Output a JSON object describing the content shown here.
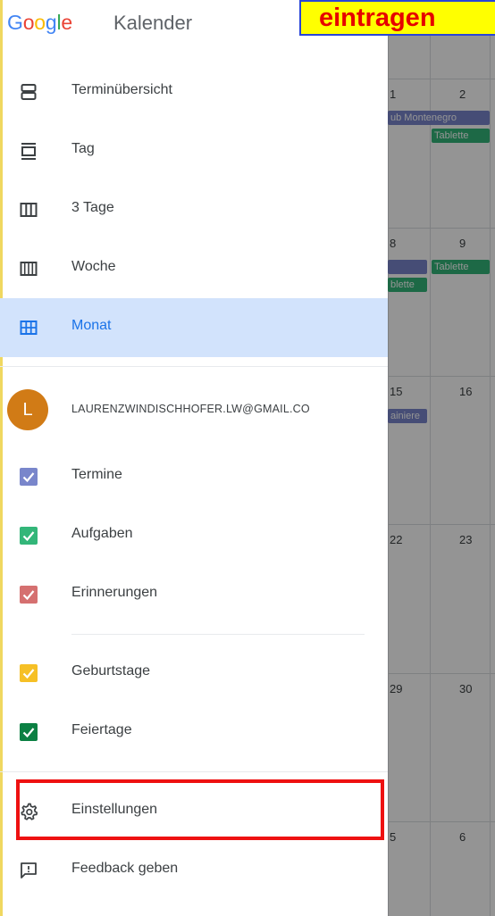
{
  "annotation": {
    "banner_text": "eintragen"
  },
  "header": {
    "logo_parts": [
      "G",
      "o",
      "o",
      "g",
      "l",
      "e"
    ],
    "app_name": "Kalender"
  },
  "views": [
    {
      "label": "Terminübersicht",
      "icon": "schedule-view-icon"
    },
    {
      "label": "Tag",
      "icon": "day-view-icon"
    },
    {
      "label": "3 Tage",
      "icon": "three-day-view-icon"
    },
    {
      "label": "Woche",
      "icon": "week-view-icon"
    },
    {
      "label": "Monat",
      "icon": "month-view-icon",
      "selected": true
    }
  ],
  "account": {
    "avatar_letter": "L",
    "email": "LAURENZWINDISCHHOFER.LW@GMAIL.CO",
    "avatar_color": "#d17b16"
  },
  "calendars": [
    {
      "label": "Termine",
      "color": "#7986cb",
      "checked": true
    },
    {
      "label": "Aufgaben",
      "color": "#33b679",
      "checked": true
    },
    {
      "label": "Erinnerungen",
      "color": "#d57070",
      "checked": true
    },
    {
      "label": "Geburtstage",
      "color": "#f6c026",
      "checked": true
    },
    {
      "label": "Feiertage",
      "color": "#0b8043",
      "checked": true
    }
  ],
  "footer": {
    "settings_label": "Einstellungen",
    "feedback_label": "Feedback geben"
  },
  "background_calendar": {
    "day_numbers": [
      "1",
      "2",
      "8",
      "9",
      "15",
      "16",
      "22",
      "23",
      "29",
      "30",
      "5",
      "6"
    ],
    "events": [
      "ub Montenegro",
      "Tablette",
      "Tablette",
      "blette",
      "ainiere"
    ]
  },
  "colors": {
    "accent": "#1a73e8",
    "selected_bg": "#d2e3fc",
    "highlight": "#ee1111",
    "banner_bg": "#ffff00",
    "banner_text": "#e60000"
  }
}
